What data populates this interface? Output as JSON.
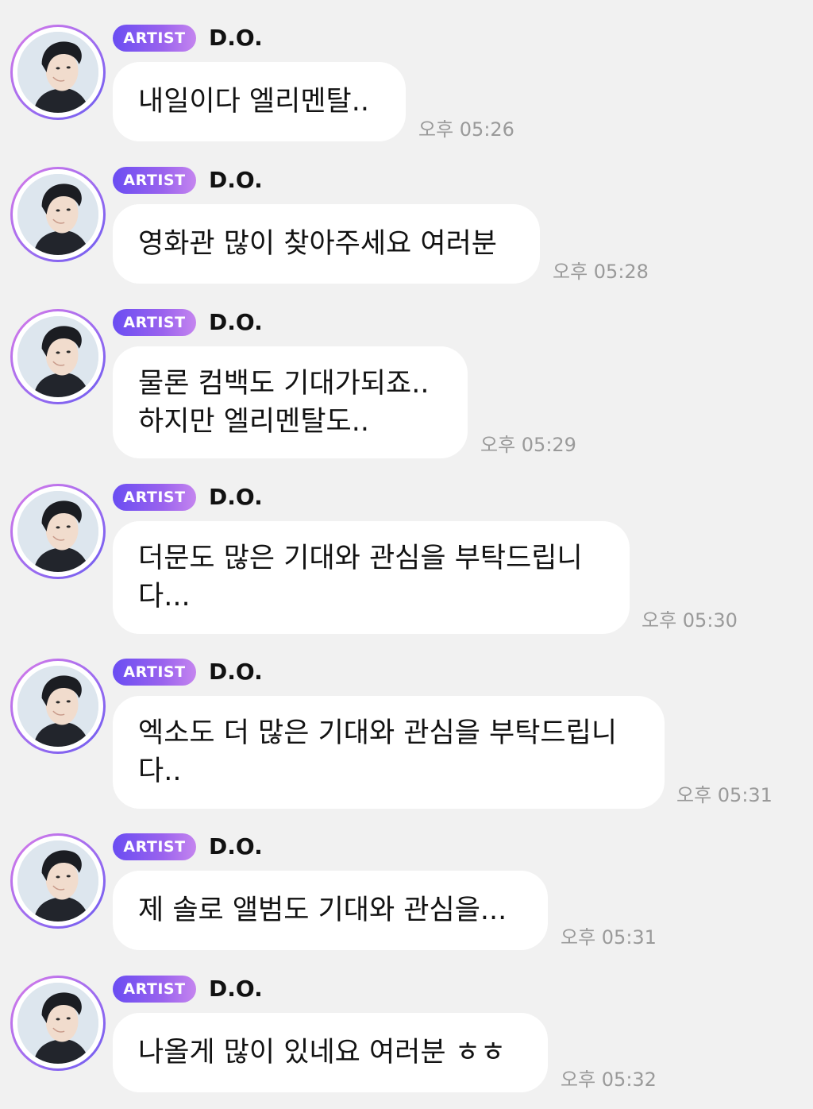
{
  "messages": [
    {
      "badge": "ARTIST",
      "name": "D.O.",
      "text": "내일이다 엘리멘탈..",
      "time": "오후 05:26"
    },
    {
      "badge": "ARTIST",
      "name": "D.O.",
      "text": "영화관 많이 찾아주세요 여러분",
      "time": "오후 05:28"
    },
    {
      "badge": "ARTIST",
      "name": "D.O.",
      "text": "물론 컴백도 기대가되죠..\n하지만 엘리멘탈도..",
      "time": "오후 05:29"
    },
    {
      "badge": "ARTIST",
      "name": "D.O.",
      "text": "더문도 많은 기대와 관심을 부탁드립니\n다...",
      "time": "오후 05:30"
    },
    {
      "badge": "ARTIST",
      "name": "D.O.",
      "text": "엑소도 더 많은 기대와 관심을 부탁드립니\n다..",
      "time": "오후 05:31"
    },
    {
      "badge": "ARTIST",
      "name": "D.O.",
      "text": "제 솔로 앨범도 기대와 관심을...",
      "time": "오후 05:31"
    },
    {
      "badge": "ARTIST",
      "name": "D.O.",
      "text": "나올게 많이 있네요 여러분 ㅎㅎ",
      "time": "오후 05:32"
    }
  ]
}
